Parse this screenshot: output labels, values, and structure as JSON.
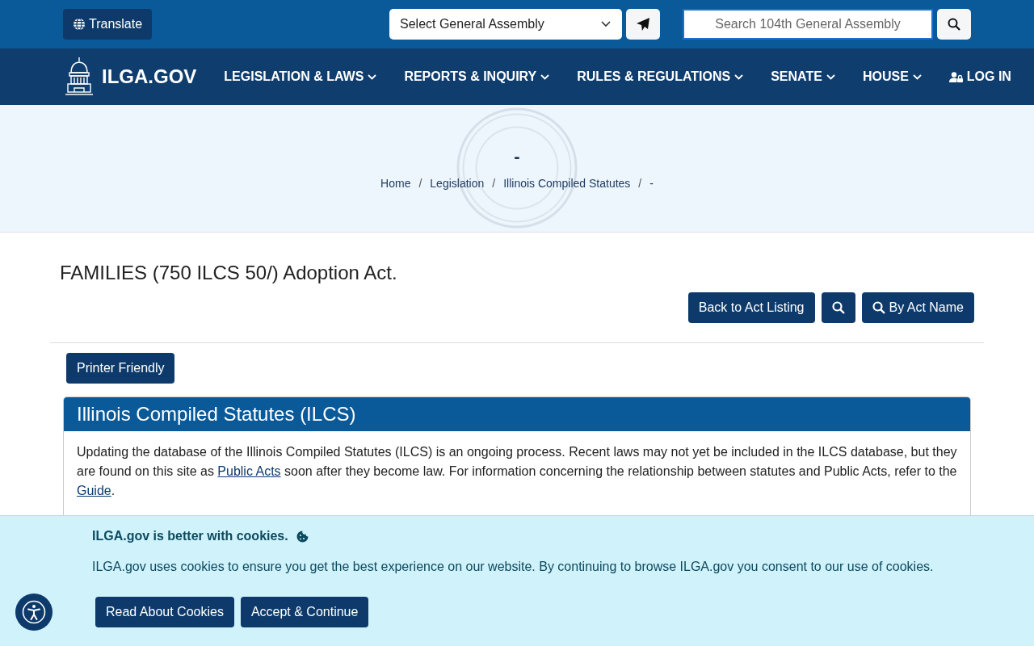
{
  "topbar": {
    "translate": "Translate",
    "assembly_select": "Select General Assembly",
    "search": {
      "placeholder": "Search 104th General Assembly"
    }
  },
  "nav": {
    "logo": "ILGA.GOV",
    "items": [
      {
        "label": "LEGISLATION & LAWS",
        "kind": "dropdown"
      },
      {
        "label": "REPORTS & INQUIRY",
        "kind": "dropdown"
      },
      {
        "label": "RULES & REGULATIONS",
        "kind": "dropdown"
      },
      {
        "label": "SENATE",
        "kind": "dropdown"
      },
      {
        "label": "HOUSE",
        "kind": "dropdown"
      },
      {
        "label": "LOG IN",
        "kind": "login"
      }
    ]
  },
  "hero": {
    "title": "-",
    "breadcrumb": [
      "Home",
      "Legislation",
      "Illinois Compiled Statutes",
      "-"
    ],
    "separator": "/"
  },
  "page": {
    "title": "FAMILIES (750 ILCS 50/) Adoption Act.",
    "actions": [
      {
        "label": "Back to Act Listing",
        "kind": "text"
      },
      {
        "kind": "search"
      },
      {
        "label": "By Act Name",
        "kind": "search"
      }
    ],
    "printer": "Printer Friendly"
  },
  "card": {
    "title": "Illinois Compiled Statutes (ILCS)",
    "paragraph": [
      {
        "kind": "text",
        "text": "Updating the database of the Illinois Compiled Statutes (ILCS) is an ongoing process. Recent laws may not yet be included in the ILCS database, but they are found on this site as "
      },
      {
        "kind": "link",
        "text": "Public Acts"
      },
      {
        "kind": "text",
        "text": " soon after they become law. For information concerning the relationship between statutes and Public Acts, refer to the "
      },
      {
        "kind": "link",
        "text": "Guide"
      },
      {
        "kind": "text",
        "text": "."
      }
    ]
  },
  "cookies": {
    "title": "ILGA.gov is better with cookies.",
    "message": "ILGA.gov uses cookies to ensure you get the best experience on our website. By continuing to browse ILGA.gov you consent to our use of cookies.",
    "buttons": [
      "Read About Cookies",
      "Accept & Continue"
    ]
  }
}
